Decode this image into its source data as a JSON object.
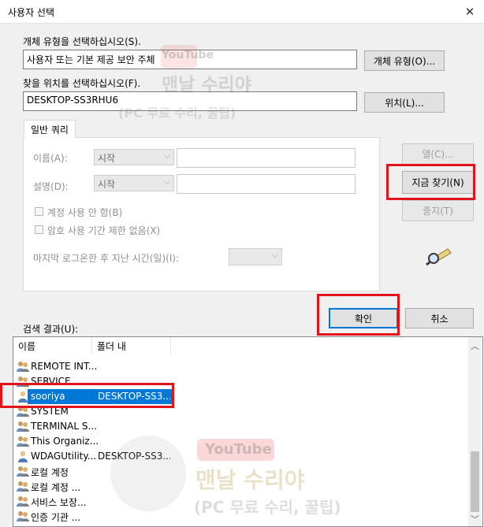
{
  "window": {
    "title": "사용자 선택",
    "close_glyph": "✕"
  },
  "object_type": {
    "label": "개체 유형을 선택하십시오(S).",
    "value": "사용자 또는 기본 제공 보안 주체",
    "button": "개체 유형(O)..."
  },
  "location": {
    "label": "찾을 위치를 선택하십시오(F).",
    "value": "DESKTOP-SS3RHU6",
    "button": "위치(L)..."
  },
  "query": {
    "tab": "일반 쿼리",
    "name_label": "이름(A):",
    "name_mode": "시작",
    "desc_label": "설명(D):",
    "desc_mode": "시작",
    "disabled_accounts": "계정 사용 안 함(B)",
    "no_expire": "암호 사용 기간 제한 없음(X)",
    "days_since_logon": "마지막 로그온한 후 지난 시간(일)(I):"
  },
  "side_buttons": {
    "columns": "열(C)...",
    "find_now": "지금 찾기(N)",
    "stop": "중지(T)"
  },
  "ok": "확인",
  "cancel": "취소",
  "results": {
    "label": "검색 결과(U):",
    "col_name": "이름",
    "col_folder": "폴더 내",
    "rows": [
      {
        "name": "REMOTE INT...",
        "folder": "",
        "icon": "group-icon"
      },
      {
        "name": "SERVICE",
        "folder": "",
        "icon": "group-icon"
      },
      {
        "name": "sooriya",
        "folder": "DESKTOP-SS3...",
        "icon": "user-icon",
        "selected": true
      },
      {
        "name": "SYSTEM",
        "folder": "",
        "icon": "group-icon"
      },
      {
        "name": "TERMINAL S...",
        "folder": "",
        "icon": "group-icon"
      },
      {
        "name": "This Organiz...",
        "folder": "",
        "icon": "group-icon"
      },
      {
        "name": "WDAGUtility...",
        "folder": "DESKTOP-SS3...",
        "icon": "user-icon"
      },
      {
        "name": "로컬 계정",
        "folder": "",
        "icon": "group-icon"
      },
      {
        "name": "로컬 계정 ...",
        "folder": "",
        "icon": "group-icon"
      },
      {
        "name": "서비스 보장...",
        "folder": "",
        "icon": "group-icon"
      },
      {
        "name": "인증 기관 ...",
        "folder": "",
        "icon": "group-icon"
      }
    ]
  },
  "colors": {
    "highlight": "#0078d7",
    "annotation_red": "#e3131b"
  },
  "overlays": {
    "watermark_brand": "YouTube",
    "watermark_channel": "맨날 수리야",
    "watermark_sub": "(PC 무료 수리, 꿀팁)"
  }
}
